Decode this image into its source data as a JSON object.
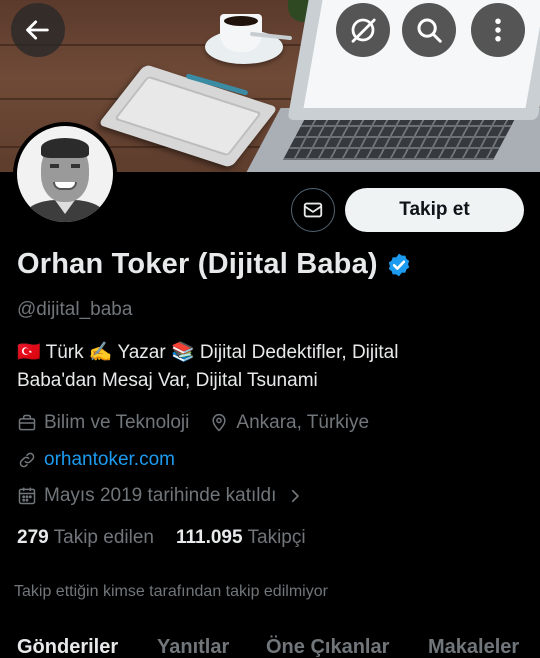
{
  "header": {
    "back_icon": "arrow-left-icon",
    "actions": [
      "hide-icon",
      "search-icon",
      "more-vertical-icon"
    ]
  },
  "profile": {
    "name": "Orhan Toker (Dijital Baba)",
    "verified": true,
    "handle": "@dijital_baba",
    "bio_line1": "🇹🇷 Türk ✍️ Yazar 📚 Dijital Dedektifler, Dijital",
    "bio_line2": "Baba'dan Mesaj Var, Dijital Tsunami",
    "category": "Bilim ve Teknoloji",
    "location": "Ankara, Türkiye",
    "website": "orhantoker.com",
    "joined": "Mayıs 2019 tarihinde katıldı",
    "following_count": "279",
    "following_label": "Takip edilen",
    "followers_count": "111.095",
    "followers_label": "Takipçi",
    "not_followed_text": "Takip ettiğin kimse tarafından takip edilmiyor"
  },
  "actions": {
    "follow_label": "Takip et",
    "message_icon": "mail-icon"
  },
  "tabs": [
    {
      "label": "Gönderiler",
      "active": true
    },
    {
      "label": "Yanıtlar",
      "active": false
    },
    {
      "label": "Öne Çıkanlar",
      "active": false
    },
    {
      "label": "Makaleler",
      "active": false
    }
  ],
  "colors": {
    "accent": "#1d9bf0",
    "background": "#000000",
    "muted": "#71767b",
    "follow_button_bg": "#eff3f4"
  }
}
